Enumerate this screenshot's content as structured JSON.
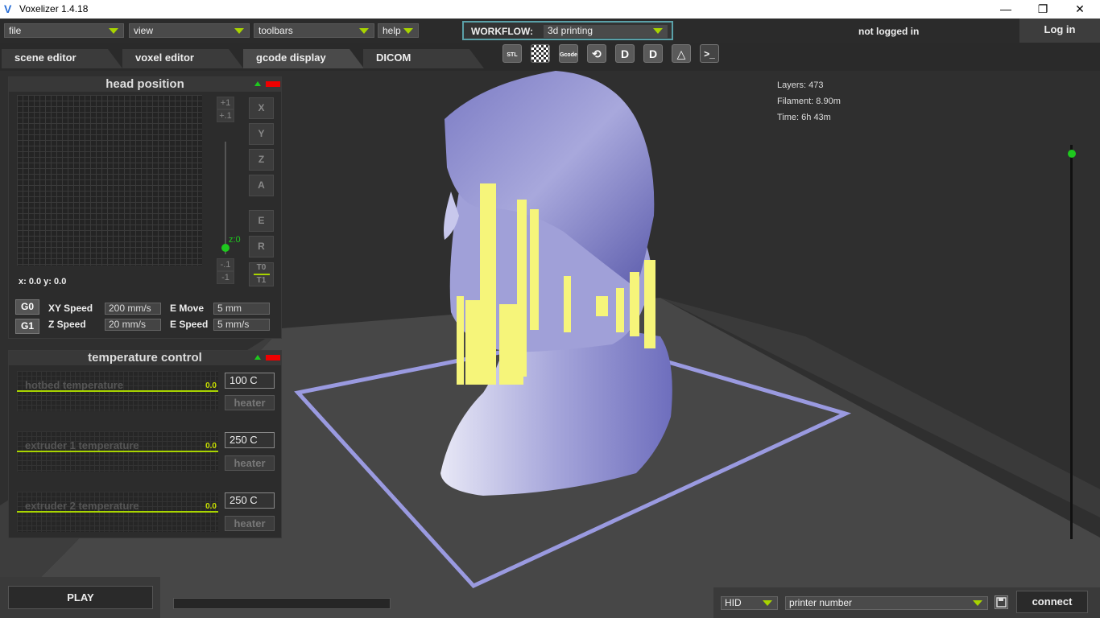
{
  "app": {
    "title": "Voxelizer 1.4.18",
    "logo": "V"
  },
  "window_controls": {
    "minimize": "—",
    "restore": "❐",
    "close": "✕"
  },
  "menu": {
    "file": "file",
    "view": "view",
    "toolbars": "toolbars",
    "help": "help"
  },
  "workflow": {
    "label": "WORKFLOW:",
    "value": "3d printing"
  },
  "account": {
    "status": "not logged in",
    "login": "Log in"
  },
  "tabs": [
    {
      "label": "scene editor"
    },
    {
      "label": "voxel editor"
    },
    {
      "label": "gcode display"
    },
    {
      "label": "DICOM"
    }
  ],
  "toolbar": {
    "stl": "STL",
    "gcode": "Gcode",
    "terminal": ">_"
  },
  "stats": {
    "layers": "Layers: 473",
    "filament": "Filament: 8.90m",
    "time": "Time: 6h 43m"
  },
  "head_position": {
    "title": "head position",
    "readout": "x: 0.0 y: 0.0",
    "z_buttons": [
      "+1",
      "+.1",
      "-.1",
      "-1"
    ],
    "z_label": "z:0",
    "axis_buttons": [
      "X",
      "Y",
      "Z",
      "A",
      "E",
      "R"
    ],
    "tool_buttons": [
      "T0",
      "T1"
    ],
    "g0": "G0",
    "g1": "G1",
    "xy_speed_label": "XY Speed",
    "xy_speed": "200 mm/s",
    "z_speed_label": "Z Speed",
    "z_speed": "20 mm/s",
    "e_move_label": "E Move",
    "e_move": "5 mm",
    "e_speed_label": "E Speed",
    "e_speed": "5 mm/s"
  },
  "temperature_control": {
    "title": "temperature control",
    "rows": [
      {
        "label": "hotbed temperature",
        "value": "0.0",
        "target": "100 C",
        "heater": "heater"
      },
      {
        "label": "extruder 1 temperature",
        "value": "0.0",
        "target": "250 C",
        "heater": "heater"
      },
      {
        "label": "extruder 2 temperature",
        "value": "0.0",
        "target": "250 C",
        "heater": "heater"
      }
    ]
  },
  "bottom": {
    "play": "PLAY",
    "port_type": "HID",
    "printer": "printer number",
    "connect": "connect"
  },
  "colors": {
    "accent": "#a8d400",
    "model": "#8e8ed0",
    "support": "#f6f57a",
    "knob": "#1ec81e"
  }
}
